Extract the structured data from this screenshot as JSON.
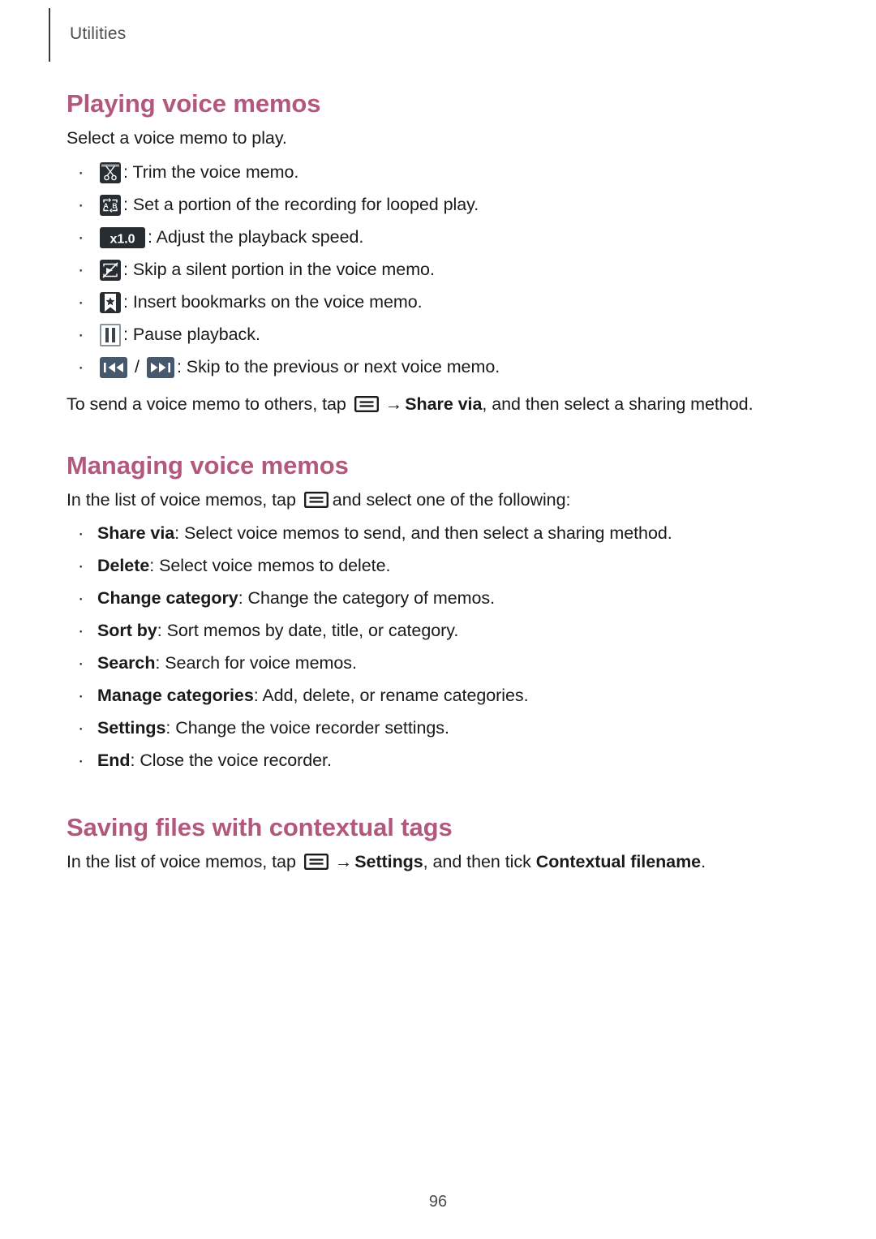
{
  "header": {
    "running_title": "Utilities"
  },
  "sections": [
    {
      "id": "playing-voice-memos",
      "title": "Playing voice memos",
      "intro": "Select a voice memo to play.",
      "bullets": [
        {
          "icon": "scissors-trim-icon",
          "text": ": Trim the voice memo."
        },
        {
          "icon": "ab-loop-icon",
          "text": ": Set a portion of the recording for looped play."
        },
        {
          "icon": "playback-speed-x1-icon",
          "icon_label": "x1.0",
          "text": ": Adjust the playback speed."
        },
        {
          "icon": "skip-silence-icon",
          "text": ": Skip a silent portion in the voice memo."
        },
        {
          "icon": "bookmark-icon",
          "text": ": Insert bookmarks on the voice memo."
        },
        {
          "icon": "pause-icon",
          "text": ": Pause playback."
        },
        {
          "icon": "skip-previous-next-icon",
          "separator": "/",
          "text": ": Skip to the previous or next voice memo."
        }
      ],
      "outro": {
        "before": "To send a voice memo to others, tap",
        "arrow": "→",
        "bold": "Share via",
        "after": ", and then select a sharing method."
      }
    },
    {
      "id": "managing-voice-memos",
      "title": "Managing voice memos",
      "intro": {
        "before": "In the list of voice memos, tap",
        "after": "and select one of the following:"
      },
      "options": [
        {
          "term": "Share via",
          "desc": ": Select voice memos to send, and then select a sharing method."
        },
        {
          "term": "Delete",
          "desc": ": Select voice memos to delete."
        },
        {
          "term": "Change category",
          "desc": ": Change the category of memos."
        },
        {
          "term": "Sort by",
          "desc": ": Sort memos by date, title, or category."
        },
        {
          "term": "Search",
          "desc": ": Search for voice memos."
        },
        {
          "term": "Manage categories",
          "desc": ": Add, delete, or rename categories."
        },
        {
          "term": "Settings",
          "desc": ": Change the voice recorder settings."
        },
        {
          "term": "End",
          "desc": ": Close the voice recorder."
        }
      ]
    },
    {
      "id": "saving-files-with-contextual-tags",
      "title": "Saving files with contextual tags",
      "intro": {
        "before": "In the list of voice memos, tap",
        "arrow": "→",
        "bold1": "Settings",
        "middle": ", and then tick ",
        "bold2": "Contextual filename",
        "end": "."
      }
    }
  ],
  "footer": {
    "page_number": "96"
  },
  "colors": {
    "heading": "#b1587c",
    "body_text": "#1a1a1a",
    "header_text": "#4d4d4d",
    "icon_dark": "#272d33",
    "icon_slate": "#46586b"
  }
}
